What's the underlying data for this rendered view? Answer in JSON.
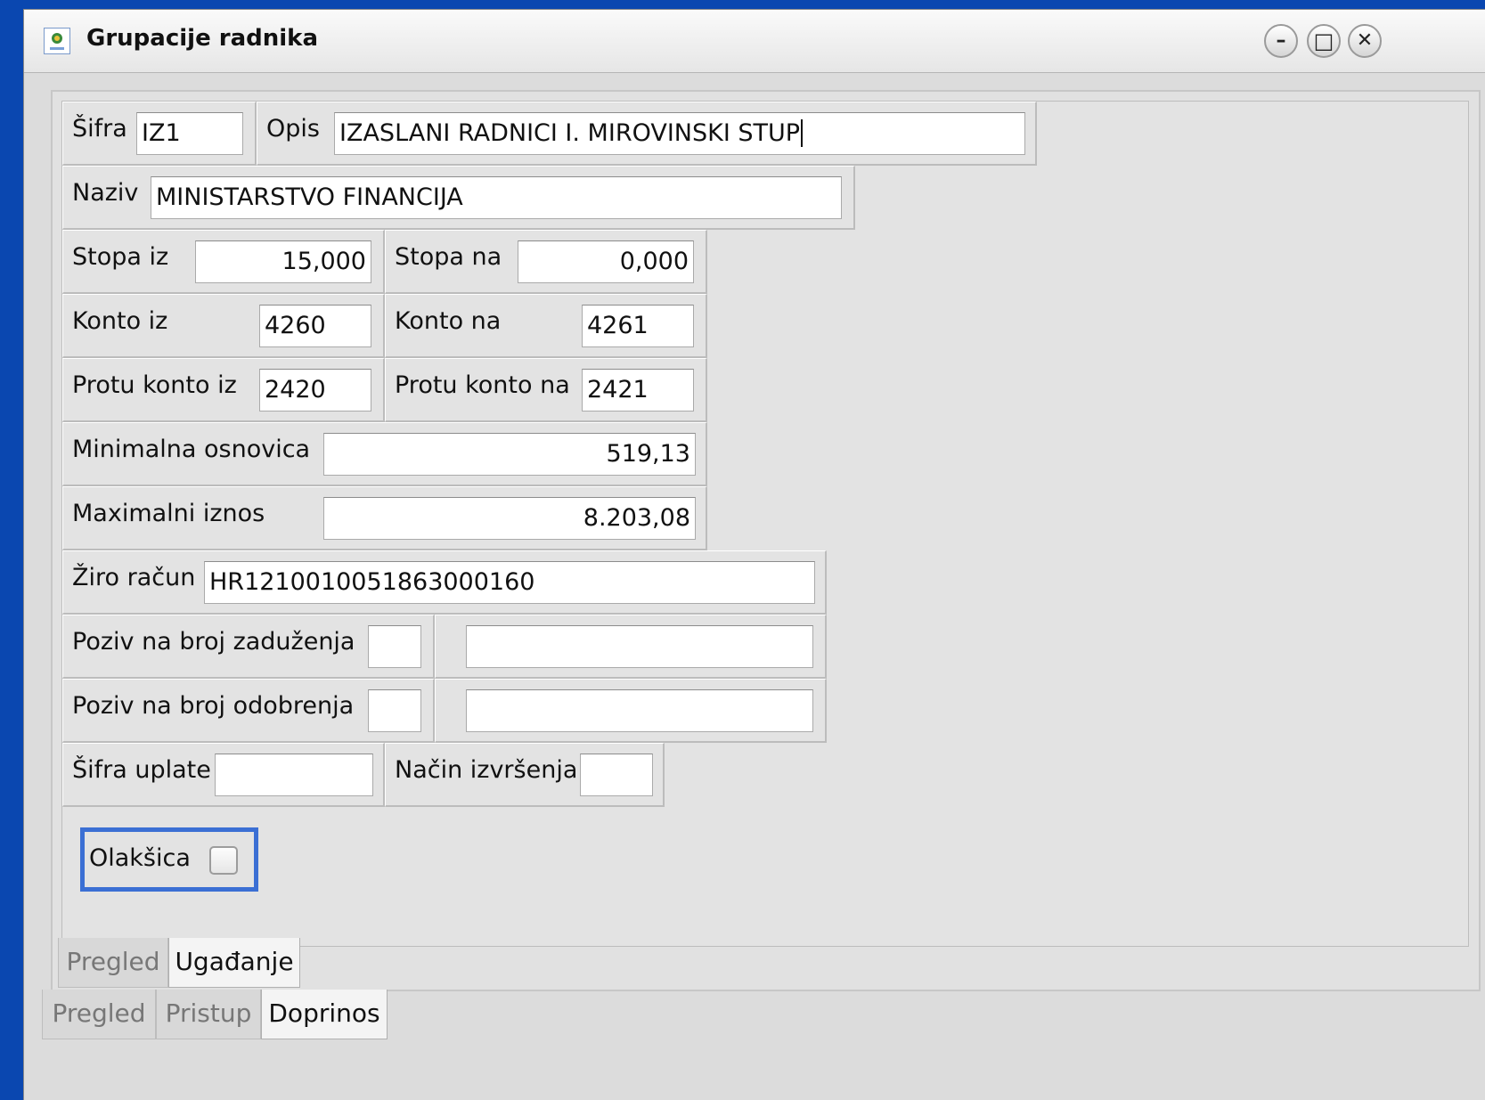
{
  "window": {
    "title": "Grupacije radnika",
    "minimize_glyph": "–",
    "maximize_glyph": "□",
    "close_glyph": "✕"
  },
  "form": {
    "sifra": {
      "label": "Šifra",
      "value": "IZ1"
    },
    "opis": {
      "label": "Opis",
      "value": "IZASLANI RADNICI I. MIROVINSKI STUP"
    },
    "naziv": {
      "label": "Naziv",
      "value": "MINISTARSTVO FINANCIJA"
    },
    "stopa_iz": {
      "label": "Stopa iz",
      "value": "15,000"
    },
    "stopa_na": {
      "label": "Stopa na",
      "value": "0,000"
    },
    "konto_iz": {
      "label": "Konto iz",
      "value": "4260"
    },
    "konto_na": {
      "label": "Konto na",
      "value": "4261"
    },
    "protu_konto_iz": {
      "label": "Protu konto iz",
      "value": "2420"
    },
    "protu_konto_na": {
      "label": "Protu konto na",
      "value": "2421"
    },
    "minimalna_osnovica": {
      "label": "Minimalna osnovica",
      "value": "519,13"
    },
    "maksimalni_iznos": {
      "label": "Maximalni iznos",
      "value": "8.203,08"
    },
    "ziro_racun": {
      "label": "Žiro račun",
      "value": "HR1210010051863000160"
    },
    "poziv_zaduzenja": {
      "label": "Poziv na broj zaduženja",
      "model": "",
      "value": ""
    },
    "poziv_odobrenja": {
      "label": "Poziv na broj odobrenja",
      "model": "",
      "value": ""
    },
    "sifra_uplate": {
      "label": "Šifra uplate",
      "value": ""
    },
    "nacin_izvrsenja": {
      "label": "Način izvršenja",
      "value": ""
    },
    "olaksica": {
      "label": "Olakšica",
      "checked": false
    }
  },
  "inner_tabs": [
    {
      "label": "Pregled",
      "active": false
    },
    {
      "label": "Ugađanje",
      "active": true
    }
  ],
  "outer_tabs": [
    {
      "label": "Pregled",
      "active": false
    },
    {
      "label": "Pristup",
      "active": false
    },
    {
      "label": "Doprinos",
      "active": true
    }
  ]
}
